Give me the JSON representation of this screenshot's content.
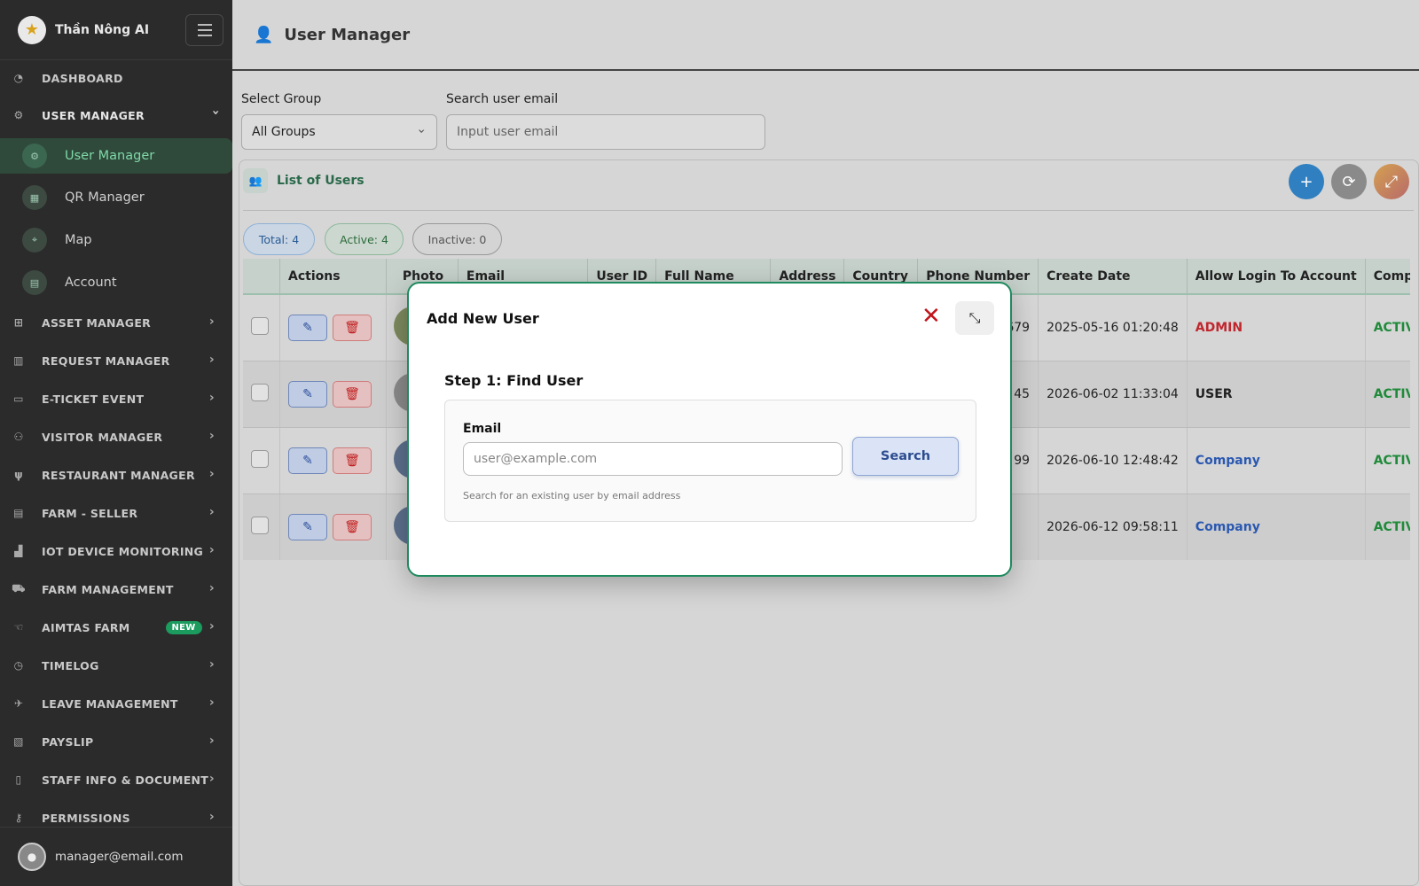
{
  "app": {
    "name": "Thần Nông AI",
    "page_title": "User Manager"
  },
  "sidebar": {
    "items": [
      {
        "label": "DASHBOARD",
        "icon": "dashboard-icon"
      },
      {
        "label": "USER MANAGER",
        "icon": "users-gear-icon",
        "expanded": true,
        "children": [
          {
            "label": "User Manager",
            "icon": "users-gear-icon",
            "active": true
          },
          {
            "label": "QR Manager",
            "icon": "qr-icon"
          },
          {
            "label": "Map",
            "icon": "map-icon"
          },
          {
            "label": "Account",
            "icon": "id-card-icon"
          }
        ]
      },
      {
        "label": "ASSET MANAGER",
        "icon": "sitemap-icon"
      },
      {
        "label": "REQUEST MANAGER",
        "icon": "clipboard-icon"
      },
      {
        "label": "E-TICKET EVENT",
        "icon": "ticket-icon"
      },
      {
        "label": "VISITOR MANAGER",
        "icon": "people-icon"
      },
      {
        "label": "RESTAURANT MANAGER",
        "icon": "utensils-icon"
      },
      {
        "label": "FARM - SELLER",
        "icon": "store-icon"
      },
      {
        "label": "IOT DEVICE MONITORING",
        "icon": "chart-icon"
      },
      {
        "label": "FARM MANAGEMENT",
        "icon": "tractor-icon"
      },
      {
        "label": "AIMTAS FARM",
        "icon": "hand-icon",
        "badge": "NEW"
      },
      {
        "label": "TIMELOG",
        "icon": "clock-icon"
      },
      {
        "label": "LEAVE MANAGEMENT",
        "icon": "plane-icon"
      },
      {
        "label": "PAYSLIP",
        "icon": "receipt-icon"
      },
      {
        "label": "STAFF INFO & DOCUMENT",
        "icon": "document-icon"
      },
      {
        "label": "PERMISSIONS",
        "icon": "key-icon"
      }
    ],
    "user_email": "manager@email.com"
  },
  "filters": {
    "group_label": "Select Group",
    "group_value": "All Groups",
    "email_label": "Search user email",
    "email_placeholder": "Input user email"
  },
  "list": {
    "title": "List of Users",
    "stats": {
      "total": "Total: 4",
      "active": "Active: 4",
      "inactive": "Inactive: 0"
    }
  },
  "table": {
    "columns": [
      "",
      "Actions",
      "Photo",
      "Email",
      "User ID",
      "Full Name",
      "Address",
      "Country",
      "Phone Number",
      "Create Date",
      "Allow Login To Account",
      "Compa"
    ],
    "rows": [
      {
        "phone": "679",
        "create_date": "2025-05-16 01:20:48",
        "role": "ADMIN",
        "role_type": "admin",
        "status": "ACTIVA"
      },
      {
        "phone": "45",
        "create_date": "2026-06-02 11:33:04",
        "role": "USER",
        "role_type": "user",
        "status": "ACTIVA"
      },
      {
        "phone": "99",
        "create_date": "2026-06-10 12:48:42",
        "role": "Company",
        "role_type": "company",
        "status": "ACTIVA"
      },
      {
        "phone": "",
        "create_date": "2026-06-12 09:58:11",
        "role": "Company",
        "role_type": "company",
        "status": "ACTIVA"
      }
    ]
  },
  "modal": {
    "title": "Add New User",
    "step": "Step 1: Find User",
    "email_label": "Email",
    "email_placeholder": "user@example.com",
    "search_label": "Search",
    "hint": "Search for an existing user by email address"
  },
  "colors": {
    "sidebar_bg": "#2b2b2b",
    "accent_green": "#1f8a5e",
    "admin_red": "#c0262d",
    "company_blue": "#2a58b0",
    "add_button": "#2f7fc1"
  }
}
